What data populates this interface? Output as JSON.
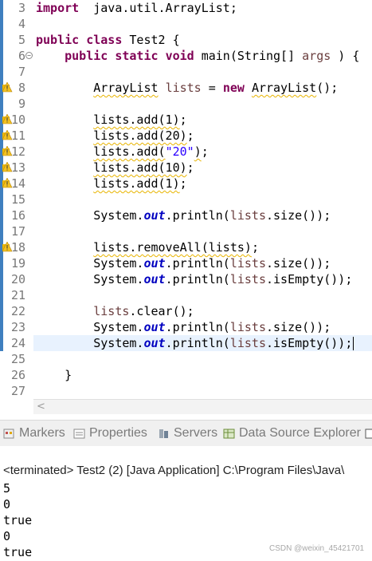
{
  "editor": {
    "lines": [
      {
        "n": "3",
        "tokens": [
          [
            "kw",
            "import"
          ],
          [
            "",
            "  java.util.ArrayList;"
          ]
        ]
      },
      {
        "n": "4",
        "tokens": []
      },
      {
        "n": "5",
        "tokens": [
          [
            "kw",
            "public"
          ],
          [
            "",
            " "
          ],
          [
            "kw",
            "class"
          ],
          [
            "",
            " Test2 {"
          ]
        ]
      },
      {
        "n": "6",
        "fold": true,
        "tokens": [
          [
            "",
            "    "
          ],
          [
            "kw",
            "public"
          ],
          [
            "",
            " "
          ],
          [
            "kw",
            "static"
          ],
          [
            "",
            " "
          ],
          [
            "kw",
            "void"
          ],
          [
            "",
            " main(String[] "
          ],
          [
            "param",
            "args"
          ],
          [
            "",
            " ) {"
          ]
        ]
      },
      {
        "n": "7",
        "tokens": []
      },
      {
        "n": "8",
        "warn": true,
        "tokens": [
          [
            "",
            "        "
          ],
          [
            "warn",
            "ArrayList"
          ],
          [
            "",
            " "
          ],
          [
            "local",
            "lists"
          ],
          [
            "",
            " = "
          ],
          [
            "kw",
            "new"
          ],
          [
            "",
            " "
          ],
          [
            "warn",
            "ArrayList"
          ],
          [
            "",
            "();"
          ]
        ]
      },
      {
        "n": "9",
        "tokens": []
      },
      {
        "n": "10",
        "warn": true,
        "tokens": [
          [
            "",
            "        "
          ],
          [
            "warn",
            "lists.add(1)"
          ],
          [
            "",
            ";"
          ]
        ]
      },
      {
        "n": "11",
        "warn": true,
        "tokens": [
          [
            "",
            "        "
          ],
          [
            "warn",
            "lists.add(20)"
          ],
          [
            "",
            ";"
          ]
        ]
      },
      {
        "n": "12",
        "warn": true,
        "tokens": [
          [
            "",
            "        "
          ],
          [
            "warn",
            "lists.add("
          ],
          [
            "str",
            "\"20\""
          ],
          [
            "warn",
            ")"
          ],
          [
            "",
            ";"
          ]
        ]
      },
      {
        "n": "13",
        "warn": true,
        "tokens": [
          [
            "",
            "        "
          ],
          [
            "warn",
            "lists.add(10)"
          ],
          [
            "",
            ";"
          ]
        ]
      },
      {
        "n": "14",
        "warn": true,
        "tokens": [
          [
            "",
            "        "
          ],
          [
            "warn",
            "lists.add(1)"
          ],
          [
            "",
            ";"
          ]
        ]
      },
      {
        "n": "15",
        "tokens": []
      },
      {
        "n": "16",
        "tokens": [
          [
            "",
            "        System."
          ],
          [
            "fld",
            "out"
          ],
          [
            "",
            ".println("
          ],
          [
            "local",
            "lists"
          ],
          [
            "",
            ".size());"
          ]
        ]
      },
      {
        "n": "17",
        "tokens": []
      },
      {
        "n": "18",
        "warn": true,
        "tokens": [
          [
            "",
            "        "
          ],
          [
            "warn",
            "lists.removeAll(lists)"
          ],
          [
            "",
            ";"
          ]
        ]
      },
      {
        "n": "19",
        "tokens": [
          [
            "",
            "        System."
          ],
          [
            "fld",
            "out"
          ],
          [
            "",
            ".println("
          ],
          [
            "local",
            "lists"
          ],
          [
            "",
            ".size());"
          ]
        ]
      },
      {
        "n": "20",
        "tokens": [
          [
            "",
            "        System."
          ],
          [
            "fld",
            "out"
          ],
          [
            "",
            ".println("
          ],
          [
            "local",
            "lists"
          ],
          [
            "",
            ".isEmpty());"
          ]
        ]
      },
      {
        "n": "21",
        "tokens": []
      },
      {
        "n": "22",
        "tokens": [
          [
            "",
            "        "
          ],
          [
            "local",
            "lists"
          ],
          [
            "",
            ".clear();"
          ]
        ]
      },
      {
        "n": "23",
        "tokens": [
          [
            "",
            "        System."
          ],
          [
            "fld",
            "out"
          ],
          [
            "",
            ".println("
          ],
          [
            "local",
            "lists"
          ],
          [
            "",
            ".size());"
          ]
        ]
      },
      {
        "n": "24",
        "current": true,
        "tokens": [
          [
            "",
            "        System."
          ],
          [
            "fld",
            "out"
          ],
          [
            "",
            ".println("
          ],
          [
            "local",
            "lists"
          ],
          [
            "",
            ".isEmpty());"
          ]
        ]
      },
      {
        "n": "25",
        "tokens": []
      },
      {
        "n": "26",
        "tokens": [
          [
            "",
            "    }"
          ]
        ]
      },
      {
        "n": "27",
        "tokens": []
      }
    ]
  },
  "tabs": [
    {
      "label": "Markers",
      "icon": "markers-icon"
    },
    {
      "label": "Properties",
      "icon": "properties-icon"
    },
    {
      "label": "Servers",
      "icon": "servers-icon"
    },
    {
      "label": "Data Source Explorer",
      "icon": "data-source-icon"
    }
  ],
  "console": {
    "header": "<terminated> Test2 (2) [Java Application] C:\\Program Files\\Java\\",
    "output": [
      "5",
      "0",
      "true",
      "0",
      "true"
    ]
  },
  "watermark": "CSDN @weixin_45421701",
  "colors": {
    "keyword": "#7f0055",
    "string": "#2a00ff",
    "field": "#0000c0",
    "local": "#6a3e3e",
    "ruler": "#3f7fbf",
    "current_line": "#e8f2fe"
  }
}
